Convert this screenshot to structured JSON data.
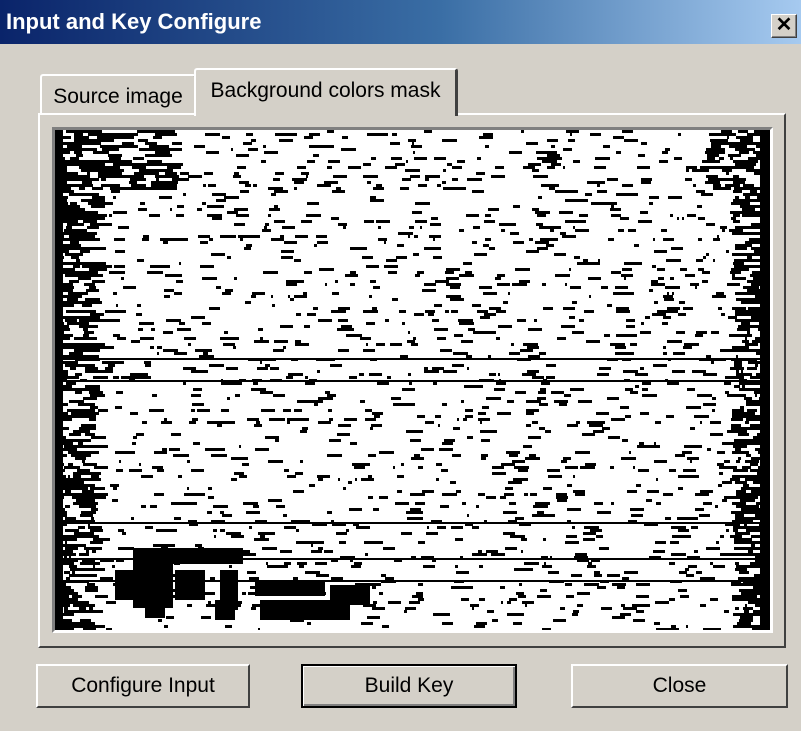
{
  "window": {
    "title": "Input and Key Configure",
    "close_glyph": "✕"
  },
  "tabs": [
    {
      "label": "Source image",
      "selected": false
    },
    {
      "label": "Background colors mask",
      "selected": true
    }
  ],
  "preview": {
    "icon": "binary-mask-image"
  },
  "buttons": {
    "configure_input": "Configure Input",
    "build_key": "Build Key",
    "close": "Close"
  },
  "colors": {
    "titlebar_start": "#0a246a",
    "titlebar_end": "#a6caf0",
    "face": "#d4d0c8",
    "mask_foreground": "#ffffff",
    "mask_background": "#000000"
  }
}
